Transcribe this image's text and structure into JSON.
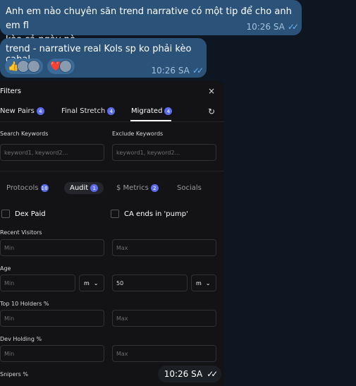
{
  "messages": [
    {
      "text_line1": "Anh em nào chuyên săn trend narrative có một tip để cho anh em fl",
      "text_line2": "kèo cả ngày nè",
      "time": "10:26 SA"
    },
    {
      "text": "trend - narrative real Kols sp ko phải kèo cabal",
      "time": "10:26 SA"
    }
  ],
  "reactions": [
    {
      "emoji": "👍"
    },
    {
      "emoji": "❤️"
    }
  ],
  "panel": {
    "title": "Filters",
    "close": "×",
    "tabs": [
      {
        "label": "New Pairs",
        "count": "4"
      },
      {
        "label": "Final Stretch",
        "count": "4"
      },
      {
        "label": "Migrated",
        "count": "4",
        "active": true
      }
    ],
    "search_label": "Search Keywords",
    "search_placeholder": "keyword1, keyword2...",
    "exclude_label": "Exclude Keywords",
    "exclude_placeholder": "keyword1, keyword2...",
    "subtabs": [
      {
        "label": "Protocols",
        "count": "18"
      },
      {
        "label": "Audit",
        "count": "1",
        "active": true
      },
      {
        "label": "$ Metrics",
        "count": "2"
      },
      {
        "label": "Socials"
      }
    ],
    "dex_paid": "Dex Paid",
    "ca_pump": "CA ends in 'pump'",
    "recent_visitors": "Recent Visitors",
    "age": "Age",
    "age_max_value": "50",
    "unit": "m",
    "top10": "Top 10 Holders %",
    "dev_holding": "Dev Holding %",
    "snipers": "Snipers %",
    "min": "Min",
    "max": "Max"
  },
  "overlay_time": "10:26 SA"
}
